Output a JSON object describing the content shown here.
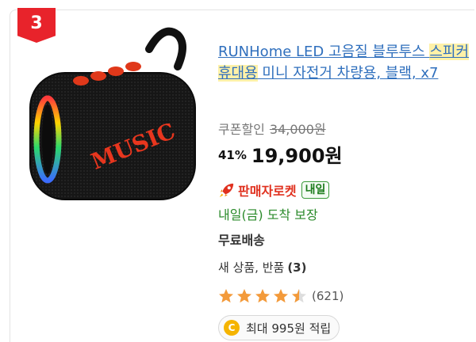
{
  "card": {
    "rank": "3",
    "product_image": {
      "icon": "speaker-image",
      "brand_text": "MUSIC"
    },
    "title": {
      "part1": "RUNHome LED 고음질 블루투스 ",
      "part2_highlight": "스피커 휴대용",
      "part3": " 미니 자전거 차량용, 블랙, x7"
    },
    "coupon_label": "쿠폰할인",
    "original_price": "34,000원",
    "discount_percent": "41%",
    "sale_price": "19,900원",
    "rocket": {
      "icon": "rocket-icon",
      "label": "판매자로켓",
      "badge": "내일"
    },
    "arrival": "내일(금) 도착 보장",
    "shipping": "무료배송",
    "return_label": "새 상품, 반품",
    "return_count": "(3)",
    "rating": {
      "stars": 4.5,
      "max": 5,
      "reviews": "(621)"
    },
    "points": {
      "icon": "coin-icon",
      "coin": "C",
      "text": "최대 995원 적립"
    }
  },
  "colors": {
    "accent_red": "#e8232b",
    "link_blue": "#2f6fbd",
    "highlight": "#fff1a8",
    "green": "#2a8a2a",
    "star": "#f39a3a"
  }
}
